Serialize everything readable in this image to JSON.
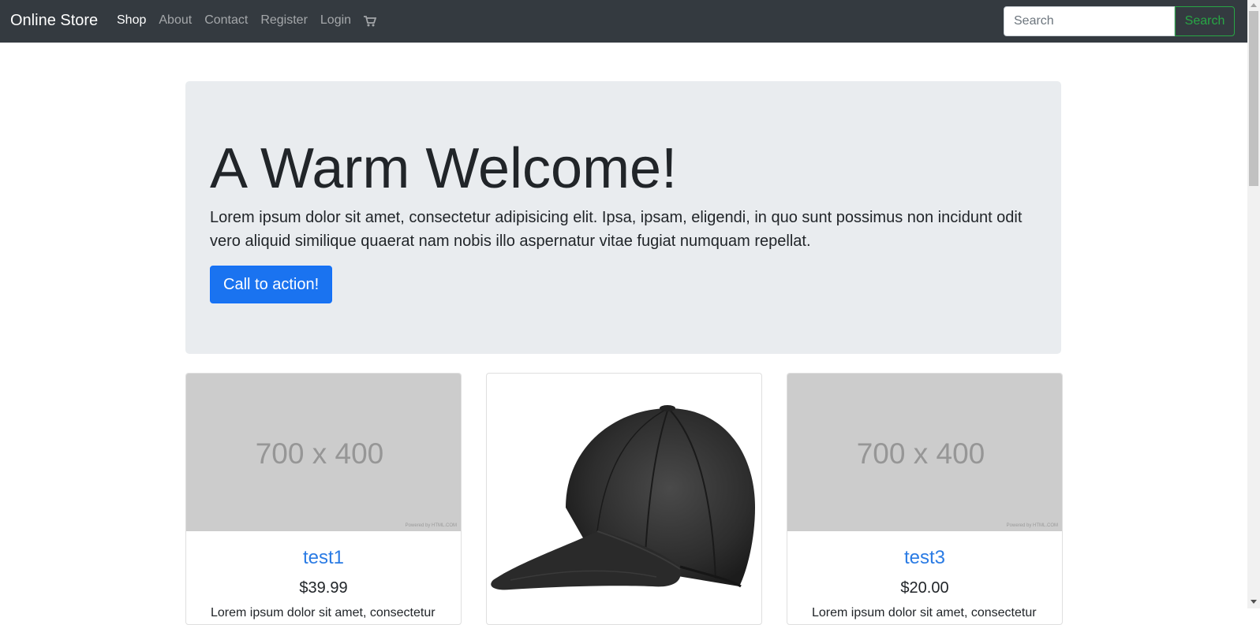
{
  "navbar": {
    "brand": "Online Store",
    "links": [
      {
        "label": "Shop",
        "active": true
      },
      {
        "label": "About",
        "active": false
      },
      {
        "label": "Contact",
        "active": false
      },
      {
        "label": "Register",
        "active": false
      },
      {
        "label": "Login",
        "active": false
      }
    ],
    "cart_icon": "shopping-cart-icon",
    "search": {
      "placeholder": "Search",
      "value": "",
      "button_label": "Search"
    }
  },
  "jumbotron": {
    "title": "A Warm Welcome!",
    "lead": "Lorem ipsum dolor sit amet, consectetur adipisicing elit. Ipsa, ipsam, eligendi, in quo sunt possimus non incidunt odit vero aliquid similique quaerat nam nobis illo aspernatur vitae fugiat numquam repellat.",
    "cta_label": "Call to action!"
  },
  "products": [
    {
      "image_text": "700 x 400",
      "image_credit": "Powered by HTML.COM",
      "title": "test1",
      "price": "$39.99",
      "text": "Lorem ipsum dolor sit amet, consectetur"
    },
    {
      "image": "black-baseball-cap",
      "title": "",
      "price": "",
      "text": ""
    },
    {
      "image_text": "700 x 400",
      "image_credit": "Powered by HTML.COM",
      "title": "test3",
      "price": "$20.00",
      "text": "Lorem ipsum dolor sit amet, consectetur"
    }
  ],
  "colors": {
    "navbar_bg": "#343a40",
    "jumbotron_bg": "#e9ecef",
    "primary": "#0d6efd",
    "success": "#28a745",
    "placeholder_bg": "#cccccc"
  }
}
